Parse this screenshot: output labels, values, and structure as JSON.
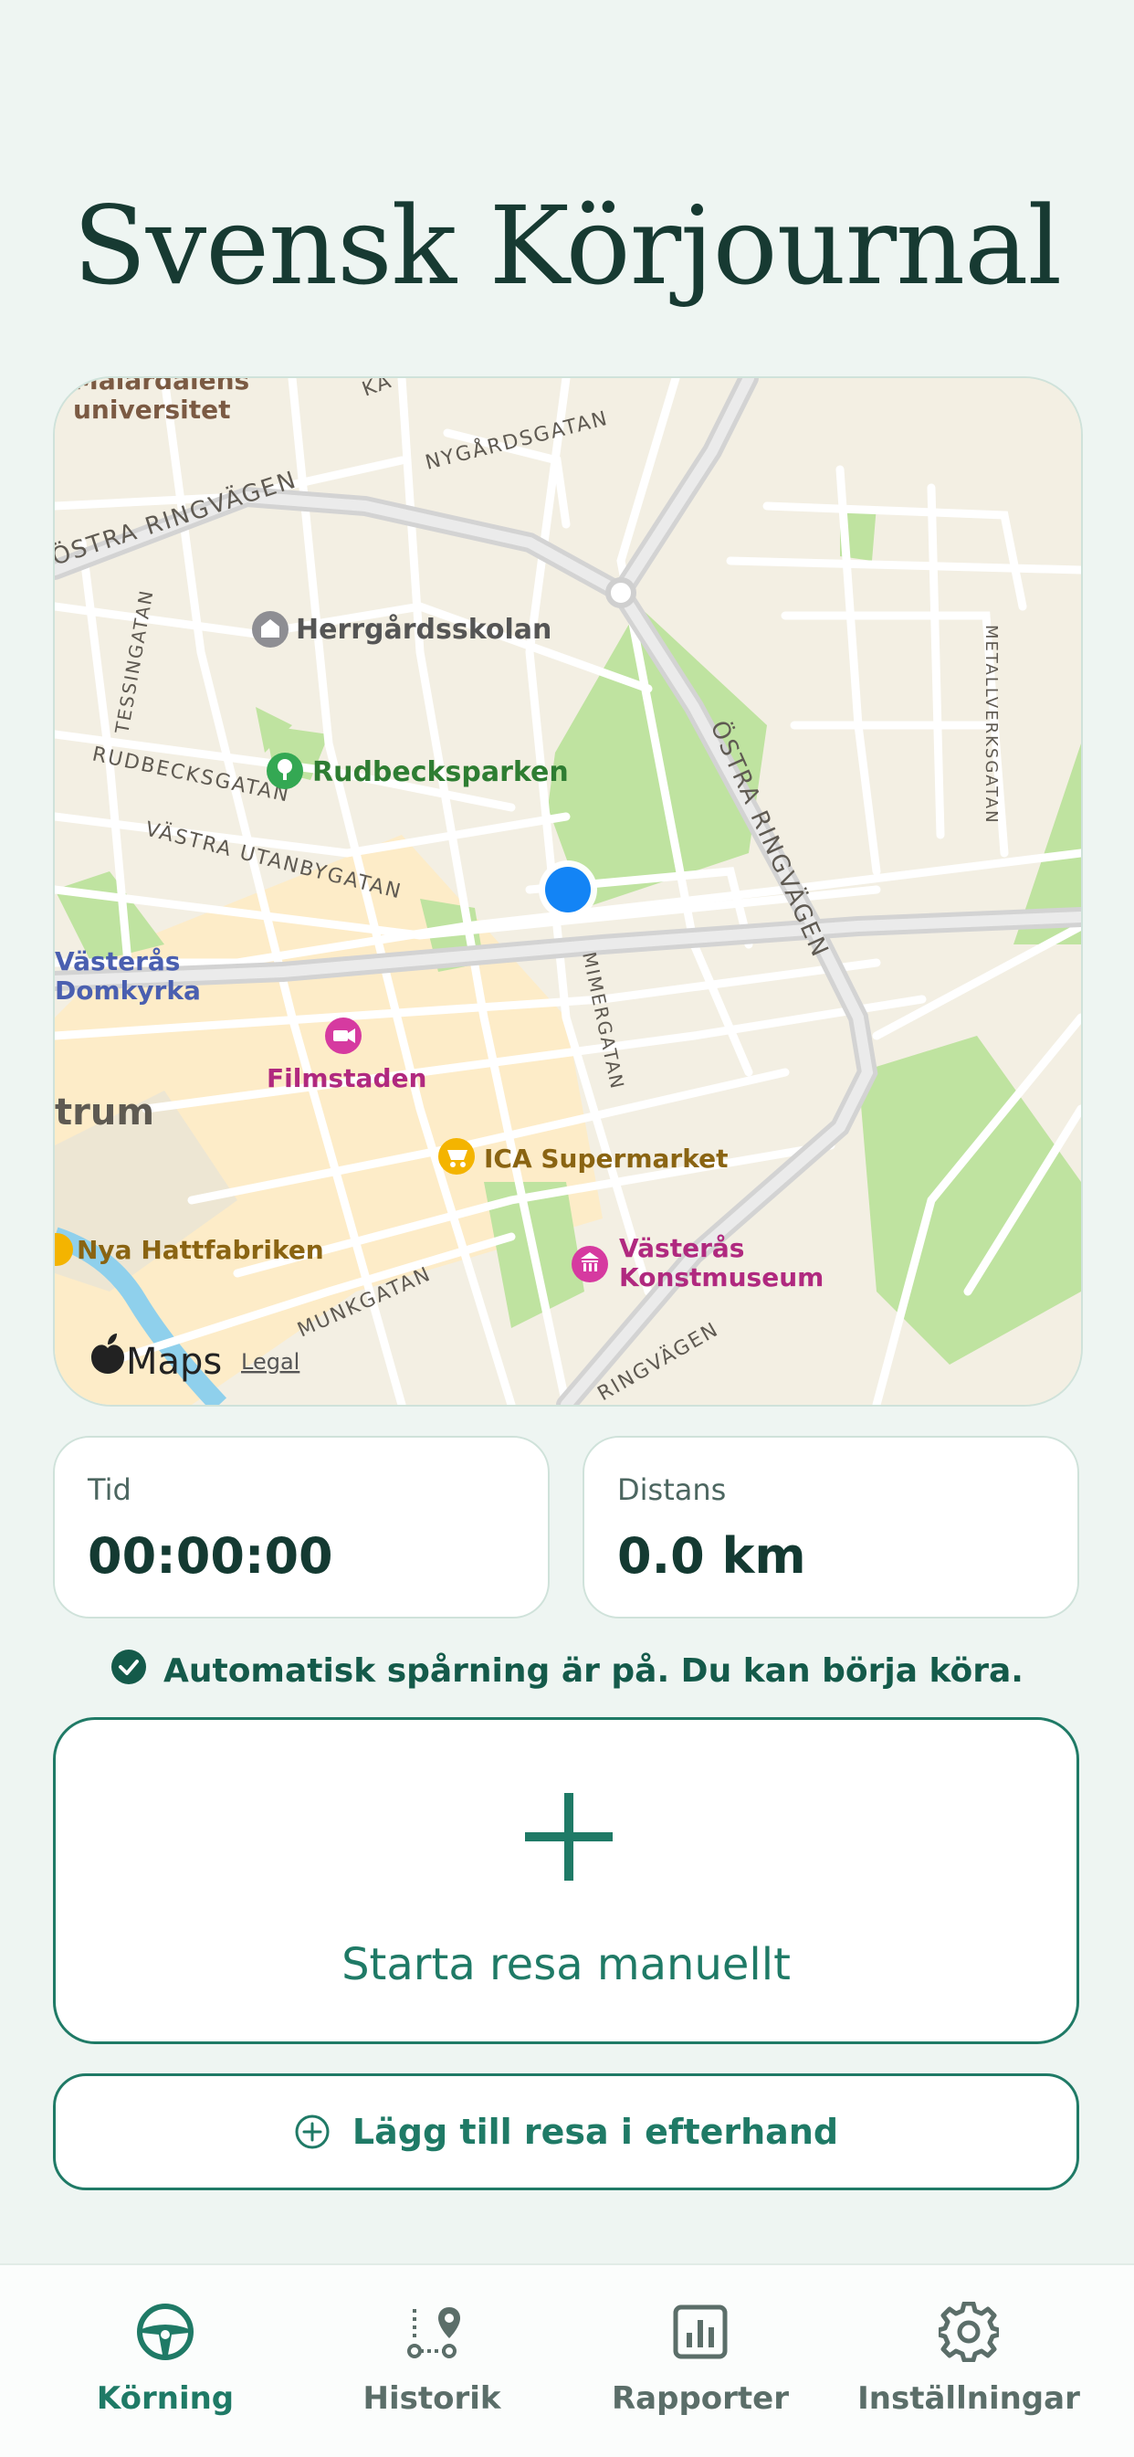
{
  "app": {
    "title": "Svensk Körjournal"
  },
  "map": {
    "labels": {
      "university_1": "Mälardalens",
      "university_2": "universitet",
      "nygardsgatan": "NYGÅRDSGATAN",
      "ka": "KA",
      "ostra_ringvagen_left": "ÖSTRA RINGVÄGEN",
      "herrgardsskolan": "Herrgårdsskolan",
      "tessingatan": "TESSINGATAN",
      "rudbecksgatan": "RUDBECKSGATAN",
      "rudbecksparken": "Rudbecksparken",
      "ostra_ringvagen_right": "ÖSTRA RINGVÄGEN",
      "metallverksgatan": "METALLVERKSGATAN",
      "vastra_utanbygatan": "VÄSTRA UTANBYGATAN",
      "domkyrka_1": "Västerås",
      "domkyrka_2": "Domkyrka",
      "mimergatan": "MIMERGATAN",
      "filmstaden": "Filmstaden",
      "centrum": "trum",
      "ica": "ICA Supermarket",
      "hattfabriken": "Nya Hattfabriken",
      "konstmuseum_1": "Västerås",
      "konstmuseum_2": "Konstmuseum",
      "munkgatan": "MUNKGATAN",
      "ringvagen_bottom": "RINGVÄGEN",
      "maps_brand": "Maps",
      "legal": "Legal"
    }
  },
  "stats": {
    "time": {
      "label": "Tid",
      "value": "00:00:00"
    },
    "distance": {
      "label": "Distans",
      "value": "0.0 km"
    }
  },
  "status": {
    "text": "Automatisk spårning är på. Du kan börja köra."
  },
  "actions": {
    "start_manual": "Starta resa manuellt",
    "add_afterwards": "Lägg till resa i efterhand"
  },
  "tabs": [
    {
      "label": "Körning"
    },
    {
      "label": "Historik"
    },
    {
      "label": "Rapporter"
    },
    {
      "label": "Inställningar"
    }
  ],
  "colors": {
    "accent": "#1f7a66",
    "location": "#1384f5"
  }
}
